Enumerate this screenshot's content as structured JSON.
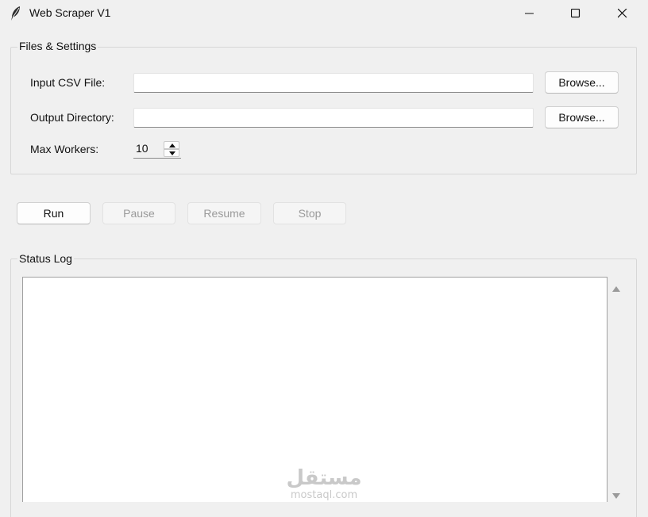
{
  "window": {
    "title": "Web Scraper V1",
    "app_icon": "feather-icon",
    "controls": [
      "minimize-icon",
      "maximize-icon",
      "close-icon"
    ]
  },
  "settings": {
    "group_label": "Files & Settings",
    "input_csv": {
      "label": "Input CSV File:",
      "value": "",
      "browse_label": "Browse..."
    },
    "output_dir": {
      "label": "Output Directory:",
      "value": "",
      "browse_label": "Browse..."
    },
    "max_workers": {
      "label": "Max Workers:",
      "value": "10"
    }
  },
  "actions": {
    "run": {
      "label": "Run",
      "enabled": true
    },
    "pause": {
      "label": "Pause",
      "enabled": false
    },
    "resume": {
      "label": "Resume",
      "enabled": false
    },
    "stop": {
      "label": "Stop",
      "enabled": false
    }
  },
  "status": {
    "group_label": "Status Log",
    "log_text": ""
  },
  "watermark": {
    "arabic": "مستقل",
    "latin": "mostaql.com"
  },
  "colors": {
    "window_bg": "#f0f0f0",
    "disabled_text": "#9a9a9a",
    "watermark": "#c9c9c9"
  }
}
